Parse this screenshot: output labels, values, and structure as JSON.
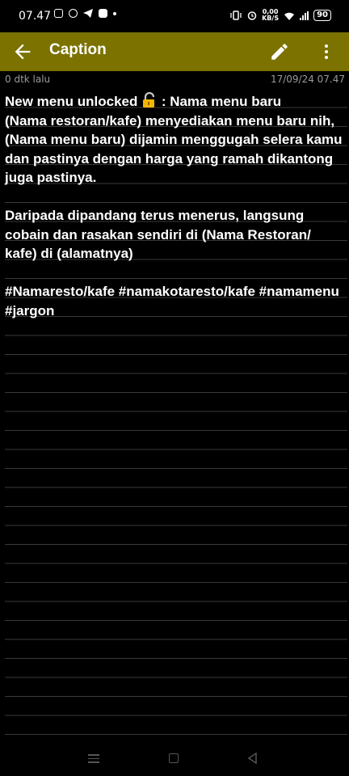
{
  "status_bar": {
    "time": "07.47",
    "net_speed_value": "0,00",
    "net_speed_unit": "KB/S",
    "battery": "90"
  },
  "app_bar": {
    "title": "Caption",
    "icons": [
      "back-arrow-icon",
      "edit-pencil-icon",
      "more-vert-icon"
    ]
  },
  "meta": {
    "last_edit": "0 dtk lalu",
    "date": "17/09/24 07.47"
  },
  "note": {
    "line1_before_icon": "New menu unlocked ",
    "line1_icon": "unlocked-padlock-icon",
    "line1_after_icon": " : Nama menu baru",
    "body": "\n(Nama restoran/kafe) menyediakan menu baru nih, (Nama menu baru) dijamin menggugah selera kamu dan pastinya dengan harga yang ramah dikantong juga pastinya.\n\nDaripada dipandang terus menerus, langsung cobain dan rasakan sendiri di (Nama Restoran/ kafe) di (alamatnya)\n\n#Namaresto/kafe #namakotaresto/kafe #namamenu #jargon"
  },
  "colors": {
    "app_bar": "#7b7200",
    "background": "#000000",
    "ruled_line": "#3a3a3a",
    "meta_text": "#9a9a9a"
  }
}
